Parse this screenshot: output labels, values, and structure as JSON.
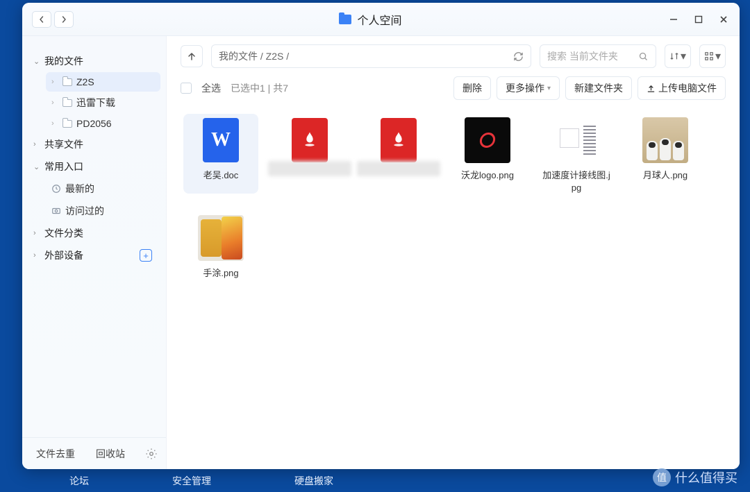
{
  "window": {
    "title": "个人空间"
  },
  "sidebar": {
    "groups": [
      {
        "label": "我的文件",
        "expanded": true,
        "items": [
          {
            "label": "Z2S",
            "selected": true
          },
          {
            "label": "迅雷下载"
          },
          {
            "label": "PD2056"
          }
        ]
      },
      {
        "label": "共享文件",
        "expanded": false
      },
      {
        "label": "常用入口",
        "expanded": true,
        "items": [
          {
            "label": "最新的",
            "icon": "clock"
          },
          {
            "label": "访问过的",
            "icon": "camera"
          }
        ]
      },
      {
        "label": "文件分类",
        "expanded": false
      },
      {
        "label": "外部设备",
        "expanded": false,
        "add": true
      }
    ],
    "footer": {
      "dedupe": "文件去重",
      "trash": "回收站"
    }
  },
  "main": {
    "path": "我的文件 / Z2S /",
    "search_placeholder": "搜索 当前文件夹",
    "select_all": "全选",
    "selection_info": "已选中1 | 共7",
    "actions": {
      "delete": "删除",
      "more": "更多操作",
      "newfolder": "新建文件夹",
      "upload": "上传电脑文件"
    },
    "files": [
      {
        "name": "老吴.doc",
        "type": "doc",
        "selected": true
      },
      {
        "name": "漫云",
        "type": "pdf",
        "blurred": true
      },
      {
        "name": "漫云",
        "type": "pdf",
        "blurred": true
      },
      {
        "name": "沃龙logo.png",
        "type": "logo"
      },
      {
        "name": "加速度计接线图.jpg",
        "type": "wire"
      },
      {
        "name": "月球人.png",
        "type": "astro"
      },
      {
        "name": "手涂.png",
        "type": "paint"
      }
    ]
  },
  "dock": {
    "items": [
      "论坛",
      "安全管理",
      "硬盘搬家"
    ]
  },
  "watermark": {
    "text": "什么值得买",
    "badge": "值"
  }
}
